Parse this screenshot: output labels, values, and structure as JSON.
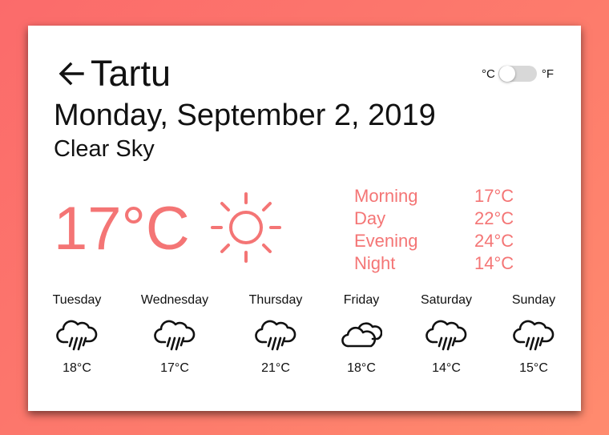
{
  "location": {
    "city": "Tartu",
    "back_icon": "arrow-left-icon"
  },
  "date": "Monday, September 2, 2019",
  "condition": "Clear Sky",
  "units": {
    "celsius_label": "°C",
    "fahrenheit_label": "°F",
    "selected": "°C"
  },
  "current": {
    "temperature": "17°C",
    "icon": "sun-icon"
  },
  "daytimes": [
    {
      "label": "Morning",
      "temp": "17°C"
    },
    {
      "label": "Day",
      "temp": "22°C"
    },
    {
      "label": "Evening",
      "temp": "24°C"
    },
    {
      "label": "Night",
      "temp": "14°C"
    }
  ],
  "forecast": [
    {
      "day": "Tuesday",
      "temp": "18°C",
      "icon": "rain-icon"
    },
    {
      "day": "Wednesday",
      "temp": "17°C",
      "icon": "rain-icon"
    },
    {
      "day": "Thursday",
      "temp": "21°C",
      "icon": "rain-icon"
    },
    {
      "day": "Friday",
      "temp": "18°C",
      "icon": "clouds-icon"
    },
    {
      "day": "Saturday",
      "temp": "14°C",
      "icon": "rain-icon"
    },
    {
      "day": "Sunday",
      "temp": "15°C",
      "icon": "rain-icon"
    }
  ],
  "colors": {
    "accent": "#f47575",
    "background_start": "#fb6b6b",
    "background_end": "#ff8b6e",
    "card": "#ffffff",
    "toggle_track": "#d8d8d8"
  }
}
